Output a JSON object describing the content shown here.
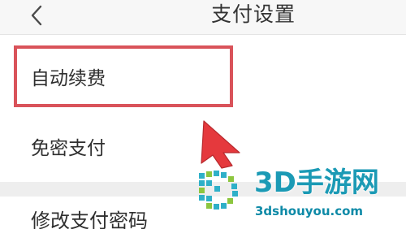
{
  "header": {
    "title": "支付设置",
    "back_icon": "chevron-left-icon"
  },
  "settings": {
    "items": [
      {
        "label": "自动续费"
      },
      {
        "label": "免密支付"
      }
    ],
    "bottom_item": {
      "label": "修改支付密码"
    }
  },
  "annotation": {
    "highlight_color": "#d9535a",
    "arrow_color": "#e5393d",
    "pointer_icon": "arrow-pointer-icon"
  },
  "watermark": {
    "brand": "3D手游网",
    "url": "3dshouyou.com",
    "logo_icon": "pixel-d-logo-icon",
    "brand_color": "#1b9ab5",
    "logo_colors": [
      "#2fb0c8",
      "#8dc63f"
    ]
  }
}
